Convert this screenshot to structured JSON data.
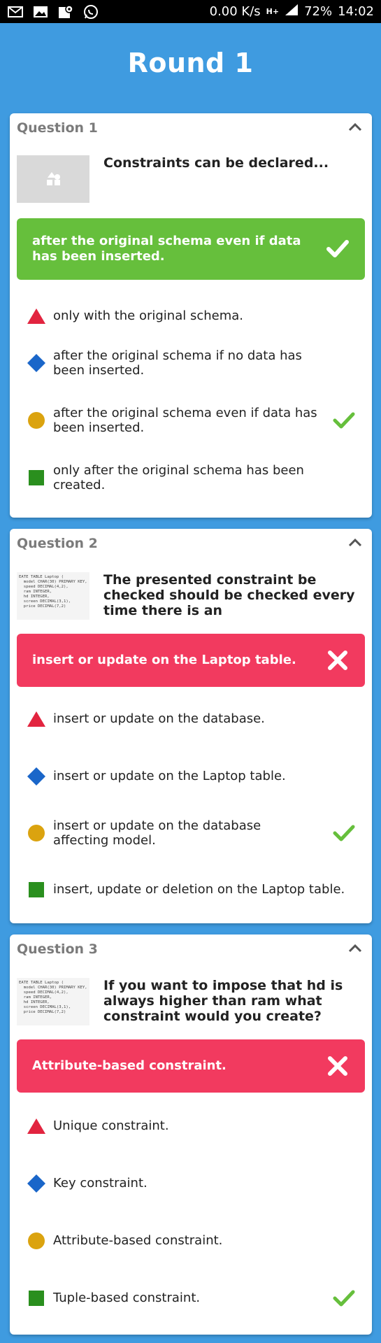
{
  "status_bar": {
    "network_speed": "0.00 K/s",
    "network_type": "H+",
    "battery": "72%",
    "time": "14:02"
  },
  "title": "Round 1",
  "questions": [
    {
      "header": "Question 1",
      "question": "Constraints can be declared...",
      "image": "placeholder-image",
      "answer": {
        "text": "after the original schema even if data has been inserted.",
        "status": "correct"
      },
      "options": [
        {
          "shape": "red-triangle",
          "text": "only with the original schema.",
          "correct": false
        },
        {
          "shape": "blue-diamond",
          "text": "after the original schema if no data has been inserted.",
          "correct": false
        },
        {
          "shape": "yellow-circle",
          "text": "after the original schema even if data has been inserted.",
          "correct": true
        },
        {
          "shape": "green-square",
          "text": "only after the original schema has been created.",
          "correct": false
        }
      ]
    },
    {
      "header": "Question 2",
      "question": "The presented constraint be checked should be checked every time there is an",
      "image": "sql-code-image",
      "code": "EATE TABLE Laptop (\n  model CHAR(30) PRIMARY KEY,\n  speed DECIMAL(4,2),\n  ram INTEGER,\n  hd INTEGER,\n  screen DECIMAL(3,1),\n  price DECIMAL(7,2)",
      "answer": {
        "text": "insert or update on the Laptop table.",
        "status": "wrong"
      },
      "options": [
        {
          "shape": "red-triangle",
          "text": "insert or update on the database.",
          "correct": false
        },
        {
          "shape": "blue-diamond",
          "text": "insert or update on the Laptop table.",
          "correct": false
        },
        {
          "shape": "yellow-circle",
          "text": "insert or update on the database affecting model.",
          "correct": true
        },
        {
          "shape": "green-square",
          "text": "insert, update or deletion on the Laptop table.",
          "correct": false
        }
      ]
    },
    {
      "header": "Question 3",
      "question": "If you want to impose that hd is always higher than ram what constraint would you create?",
      "image": "sql-code-image",
      "code": "EATE TABLE Laptop (\n  model CHAR(30) PRIMARY KEY,\n  speed DECIMAL(4,2),\n  ram INTEGER,\n  hd INTEGER,\n  screen DECIMAL(3,1),\n  price DECIMAL(7,2)",
      "answer": {
        "text": "Attribute-based constraint.",
        "status": "wrong"
      },
      "options": [
        {
          "shape": "red-triangle",
          "text": "Unique constraint.",
          "correct": false
        },
        {
          "shape": "blue-diamond",
          "text": "Key constraint.",
          "correct": false
        },
        {
          "shape": "yellow-circle",
          "text": "Attribute-based constraint.",
          "correct": false
        },
        {
          "shape": "green-square",
          "text": "Tuple-based constraint.",
          "correct": true
        }
      ]
    }
  ],
  "colors": {
    "background": "#3f9be0",
    "correct": "#66bf3c",
    "wrong": "#f23a5f",
    "triangle": "#e2243f",
    "diamond": "#1a66c9",
    "circle": "#dba30f",
    "square": "#2a8f1e"
  }
}
